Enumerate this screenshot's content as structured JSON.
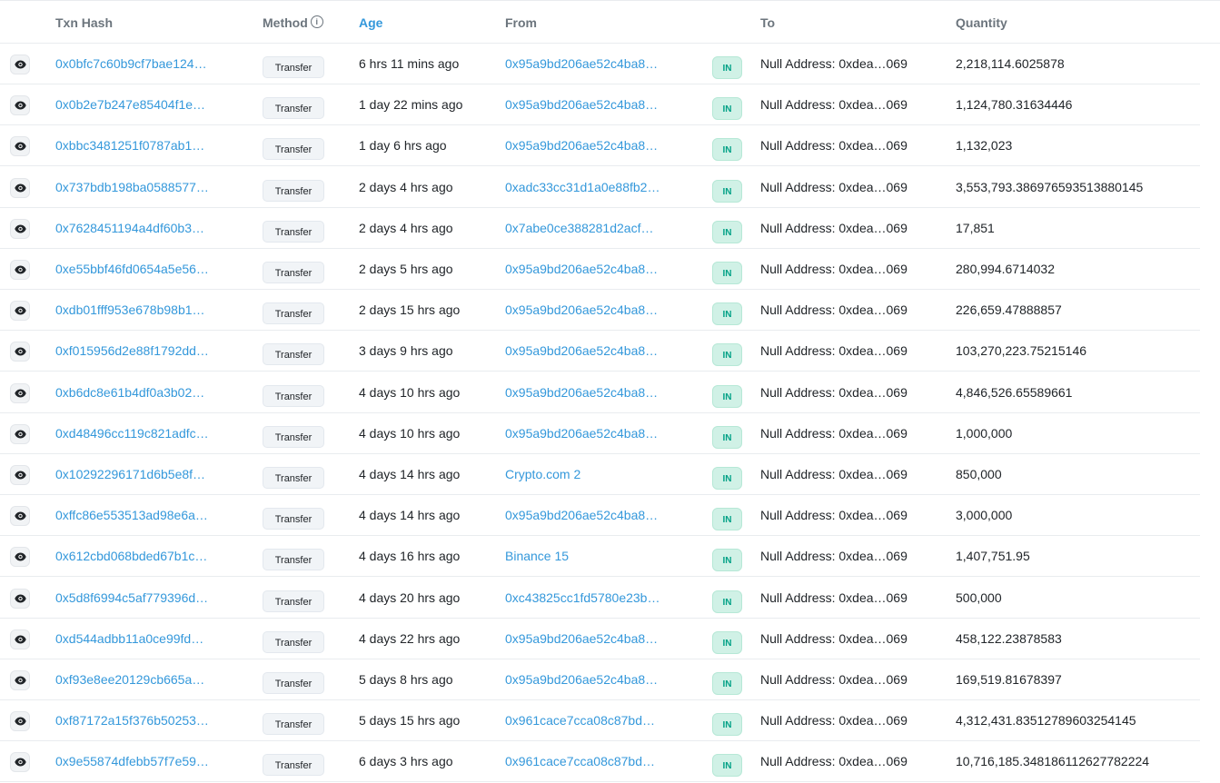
{
  "header": {
    "txn_hash": "Txn Hash",
    "method": "Method",
    "method_info_icon": "i",
    "age": "Age",
    "from": "From",
    "to": "To",
    "quantity": "Quantity"
  },
  "colors": {
    "link": "#3498db",
    "in_badge_bg": "#d0f1e6",
    "in_badge_text": "#00a186",
    "header_text": "#6c757d"
  },
  "rows": [
    {
      "hash": "0x0bfc7c60b9cf7bae124…",
      "method": "Transfer",
      "age": "6 hrs 11 mins ago",
      "from": "0x95a9bd206ae52c4ba8…",
      "direction": "IN",
      "to": "Null Address: 0xdea…069",
      "quantity": "2,218,114.6025878"
    },
    {
      "hash": "0x0b2e7b247e85404f1e…",
      "method": "Transfer",
      "age": "1 day 22 mins ago",
      "from": "0x95a9bd206ae52c4ba8…",
      "direction": "IN",
      "to": "Null Address: 0xdea…069",
      "quantity": "1,124,780.31634446"
    },
    {
      "hash": "0xbbc3481251f0787ab1…",
      "method": "Transfer",
      "age": "1 day 6 hrs ago",
      "from": "0x95a9bd206ae52c4ba8…",
      "direction": "IN",
      "to": "Null Address: 0xdea…069",
      "quantity": "1,132,023"
    },
    {
      "hash": "0x737bdb198ba0588577…",
      "method": "Transfer",
      "age": "2 days 4 hrs ago",
      "from": "0xadc33cc31d1a0e88fb2…",
      "direction": "IN",
      "to": "Null Address: 0xdea…069",
      "quantity": "3,553,793.386976593513880145"
    },
    {
      "hash": "0x7628451194a4df60b3…",
      "method": "Transfer",
      "age": "2 days 4 hrs ago",
      "from": "0x7abe0ce388281d2acf…",
      "direction": "IN",
      "to": "Null Address: 0xdea…069",
      "quantity": "17,851"
    },
    {
      "hash": "0xe55bbf46fd0654a5e56…",
      "method": "Transfer",
      "age": "2 days 5 hrs ago",
      "from": "0x95a9bd206ae52c4ba8…",
      "direction": "IN",
      "to": "Null Address: 0xdea…069",
      "quantity": "280,994.6714032"
    },
    {
      "hash": "0xdb01fff953e678b98b1…",
      "method": "Transfer",
      "age": "2 days 15 hrs ago",
      "from": "0x95a9bd206ae52c4ba8…",
      "direction": "IN",
      "to": "Null Address: 0xdea…069",
      "quantity": "226,659.47888857"
    },
    {
      "hash": "0xf015956d2e88f1792dd…",
      "method": "Transfer",
      "age": "3 days 9 hrs ago",
      "from": "0x95a9bd206ae52c4ba8…",
      "direction": "IN",
      "to": "Null Address: 0xdea…069",
      "quantity": "103,270,223.75215146"
    },
    {
      "hash": "0xb6dc8e61b4df0a3b02…",
      "method": "Transfer",
      "age": "4 days 10 hrs ago",
      "from": "0x95a9bd206ae52c4ba8…",
      "direction": "IN",
      "to": "Null Address: 0xdea…069",
      "quantity": "4,846,526.65589661"
    },
    {
      "hash": "0xd48496cc119c821adfc…",
      "method": "Transfer",
      "age": "4 days 10 hrs ago",
      "from": "0x95a9bd206ae52c4ba8…",
      "direction": "IN",
      "to": "Null Address: 0xdea…069",
      "quantity": "1,000,000"
    },
    {
      "hash": "0x10292296171d6b5e8f…",
      "method": "Transfer",
      "age": "4 days 14 hrs ago",
      "from": "Crypto.com 2",
      "direction": "IN",
      "to": "Null Address: 0xdea…069",
      "quantity": "850,000"
    },
    {
      "hash": "0xffc86e553513ad98e6a…",
      "method": "Transfer",
      "age": "4 days 14 hrs ago",
      "from": "0x95a9bd206ae52c4ba8…",
      "direction": "IN",
      "to": "Null Address: 0xdea…069",
      "quantity": "3,000,000"
    },
    {
      "hash": "0x612cbd068bded67b1c…",
      "method": "Transfer",
      "age": "4 days 16 hrs ago",
      "from": "Binance 15",
      "direction": "IN",
      "to": "Null Address: 0xdea…069",
      "quantity": "1,407,751.95"
    },
    {
      "hash": "0x5d8f6994c5af779396d…",
      "method": "Transfer",
      "age": "4 days 20 hrs ago",
      "from": "0xc43825cc1fd5780e23b…",
      "direction": "IN",
      "to": "Null Address: 0xdea…069",
      "quantity": "500,000"
    },
    {
      "hash": "0xd544adbb11a0ce99fd…",
      "method": "Transfer",
      "age": "4 days 22 hrs ago",
      "from": "0x95a9bd206ae52c4ba8…",
      "direction": "IN",
      "to": "Null Address: 0xdea…069",
      "quantity": "458,122.23878583"
    },
    {
      "hash": "0xf93e8ee20129cb665a…",
      "method": "Transfer",
      "age": "5 days 8 hrs ago",
      "from": "0x95a9bd206ae52c4ba8…",
      "direction": "IN",
      "to": "Null Address: 0xdea…069",
      "quantity": "169,519.81678397"
    },
    {
      "hash": "0xf87172a15f376b50253…",
      "method": "Transfer",
      "age": "5 days 15 hrs ago",
      "from": "0x961cace7cca08c87bd…",
      "direction": "IN",
      "to": "Null Address: 0xdea…069",
      "quantity": "4,312,431.83512789603254145"
    },
    {
      "hash": "0x9e55874dfebb57f7e59…",
      "method": "Transfer",
      "age": "6 days 3 hrs ago",
      "from": "0x961cace7cca08c87bd…",
      "direction": "IN",
      "to": "Null Address: 0xdea…069",
      "quantity": "10,716,185.348186112627782224"
    }
  ]
}
